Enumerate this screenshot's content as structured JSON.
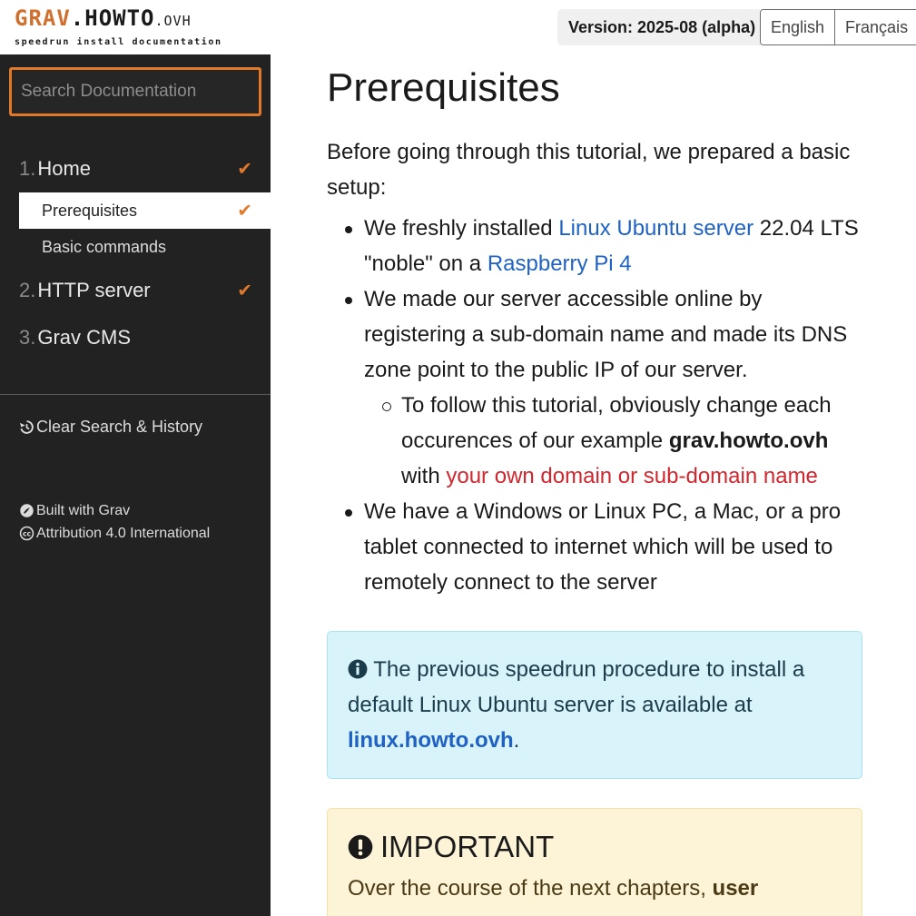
{
  "logo": {
    "grav": "GRAV",
    "dot": ".",
    "howto": "HOWTO",
    "ovh": ".OVH",
    "subtitle": "speedrun install documentation"
  },
  "header": {
    "version": "Version: 2025-08 (alpha)",
    "languages": [
      "English",
      "Français"
    ]
  },
  "sidebar": {
    "search_placeholder": "Search Documentation",
    "nav": [
      {
        "num": "1.",
        "label": "Home",
        "checked": true
      },
      {
        "num": "2.",
        "label": "HTTP server",
        "checked": true
      },
      {
        "num": "3.",
        "label": "Grav CMS",
        "checked": false
      }
    ],
    "sub_items": [
      {
        "label": "Prerequisites",
        "checked": true,
        "active": true
      },
      {
        "label": "Basic commands",
        "checked": false,
        "active": false
      }
    ],
    "clear_label": "Clear Search & History",
    "built_with": "Built with Grav",
    "license": "Attribution 4.0 International"
  },
  "content": {
    "title": "Prerequisites",
    "intro": "Before going through this tutorial, we prepared a basic setup:",
    "b1_pre": "We freshly installed ",
    "b1_link1": "Linux Ubuntu server",
    "b1_mid": " 22.04 LTS \"noble\" on a ",
    "b1_link2": "Raspberry Pi 4",
    "b2": "We made our server accessible online by registering a sub-domain name and made its DNS zone point to the public IP of our server.",
    "b2_sub_pre": "To follow this tutorial, obviously change each occurences of our example ",
    "b2_sub_bold": "grav.howto.ovh",
    "b2_sub_mid": " with ",
    "b2_sub_red": "your own domain or sub-domain name",
    "b3": "We have a Windows or Linux PC, a Mac, or a pro tablet connected to internet which will be used to remotely connect to the server",
    "note_text": "The previous speedrun procedure to install a default Linux Ubuntu server is available at ",
    "note_link": "linux.howto.ovh",
    "note_end": ".",
    "important_title": "IMPORTANT",
    "important_text": "Over the course of the next chapters, ",
    "important_bold": "user"
  },
  "colors": {
    "accent": "#e0792a",
    "sidebar_bg": "#222222",
    "link": "#1f62c4",
    "red": "#d0272e",
    "note_bg": "#d9f3fb",
    "important_bg": "#fdf3d6"
  }
}
